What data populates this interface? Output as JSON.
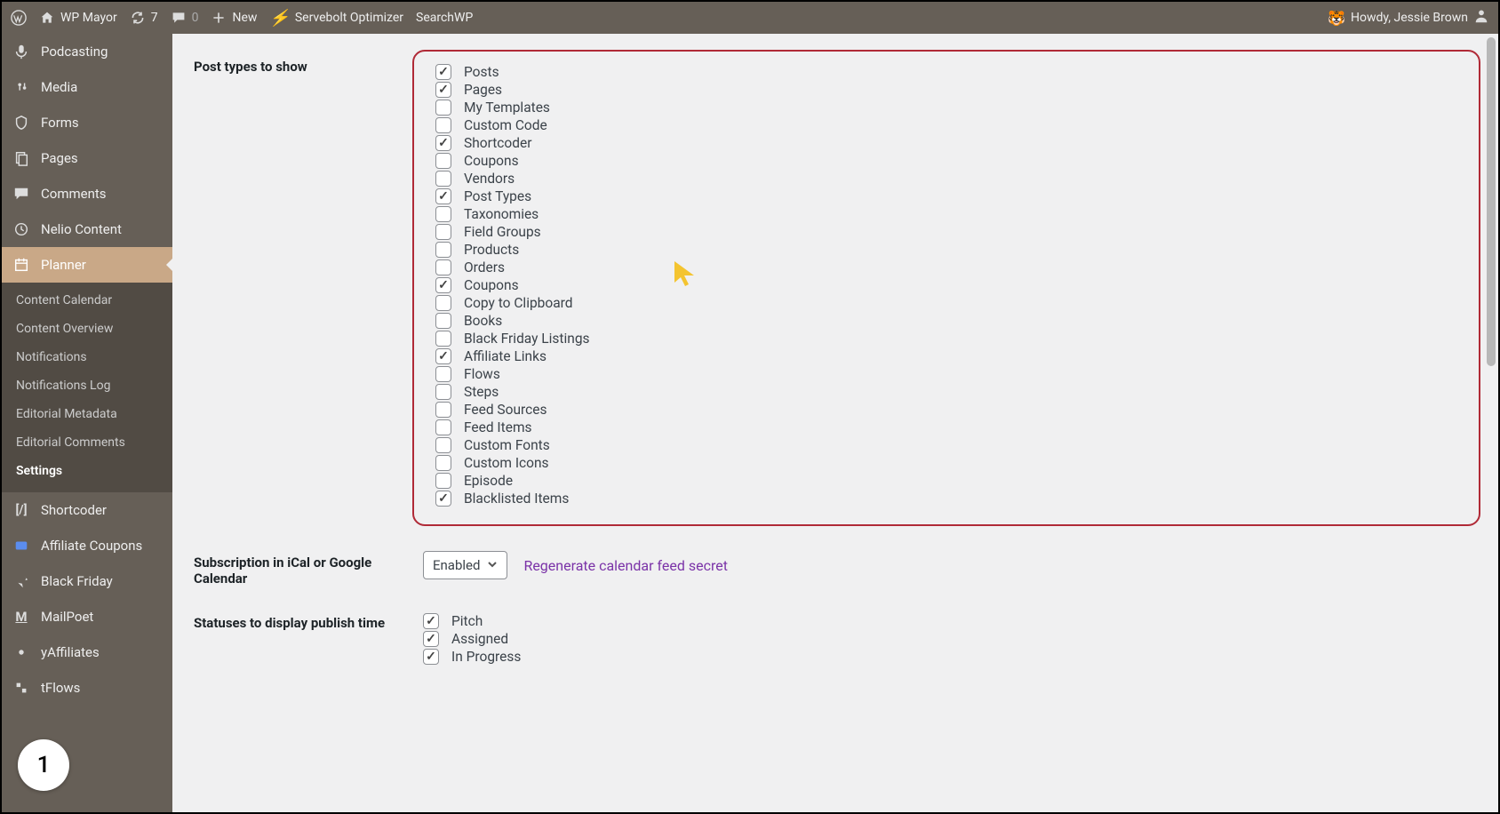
{
  "adminbar": {
    "site_name": "WP Mayor",
    "updates_count": "7",
    "comments_count": "0",
    "new_label": "New",
    "servebolt": "Servebolt Optimizer",
    "searchwp": "SearchWP",
    "howdy": "Howdy, Jessie Brown"
  },
  "sidebar": {
    "items": [
      {
        "label": "Podcasting",
        "icon": "mic"
      },
      {
        "label": "Media",
        "icon": "media"
      },
      {
        "label": "Forms",
        "icon": "forms"
      },
      {
        "label": "Pages",
        "icon": "pages"
      },
      {
        "label": "Comments",
        "icon": "comments"
      },
      {
        "label": "Nelio Content",
        "icon": "clock"
      },
      {
        "label": "Planner",
        "icon": "calendar",
        "active": true
      },
      {
        "label": "Shortcoder",
        "icon": "shortcode"
      },
      {
        "label": "Affiliate Coupons",
        "icon": "coupon"
      },
      {
        "label": "Black Friday",
        "icon": "pin"
      },
      {
        "label": "MailPoet",
        "icon": "mailpoet"
      },
      {
        "label": "yAffiliates",
        "icon": "affiliate"
      },
      {
        "label": "tFlows",
        "icon": "flows"
      }
    ],
    "submenu": [
      {
        "label": "Content Calendar"
      },
      {
        "label": "Content Overview"
      },
      {
        "label": "Notifications"
      },
      {
        "label": "Notifications Log"
      },
      {
        "label": "Editorial Metadata"
      },
      {
        "label": "Editorial Comments"
      },
      {
        "label": "Settings",
        "current": true
      }
    ]
  },
  "settings": {
    "post_types_label": "Post types to show",
    "post_types": [
      {
        "label": "Posts",
        "checked": true
      },
      {
        "label": "Pages",
        "checked": true
      },
      {
        "label": "My Templates",
        "checked": false
      },
      {
        "label": "Custom Code",
        "checked": false
      },
      {
        "label": "Shortcoder",
        "checked": true
      },
      {
        "label": "Coupons",
        "checked": false
      },
      {
        "label": "Vendors",
        "checked": false
      },
      {
        "label": "Post Types",
        "checked": true
      },
      {
        "label": "Taxonomies",
        "checked": false
      },
      {
        "label": "Field Groups",
        "checked": false
      },
      {
        "label": "Products",
        "checked": false
      },
      {
        "label": "Orders",
        "checked": false
      },
      {
        "label": "Coupons",
        "checked": true
      },
      {
        "label": "Copy to Clipboard",
        "checked": false
      },
      {
        "label": "Books",
        "checked": false
      },
      {
        "label": "Black Friday Listings",
        "checked": false
      },
      {
        "label": "Affiliate Links",
        "checked": true
      },
      {
        "label": "Flows",
        "checked": false
      },
      {
        "label": "Steps",
        "checked": false
      },
      {
        "label": "Feed Sources",
        "checked": false
      },
      {
        "label": "Feed Items",
        "checked": false
      },
      {
        "label": "Custom Fonts",
        "checked": false
      },
      {
        "label": "Custom Icons",
        "checked": false
      },
      {
        "label": "Episode",
        "checked": false
      },
      {
        "label": "Blacklisted Items",
        "checked": true
      }
    ],
    "subscription_label": "Subscription in iCal or Google Calendar",
    "subscription_select": "Enabled",
    "regenerate_link": "Regenerate calendar feed secret",
    "statuses_label": "Statuses to display publish time",
    "statuses": [
      {
        "label": "Pitch",
        "checked": true
      },
      {
        "label": "Assigned",
        "checked": true
      },
      {
        "label": "In Progress",
        "checked": true
      }
    ]
  },
  "annotation": {
    "bubble": "1"
  }
}
